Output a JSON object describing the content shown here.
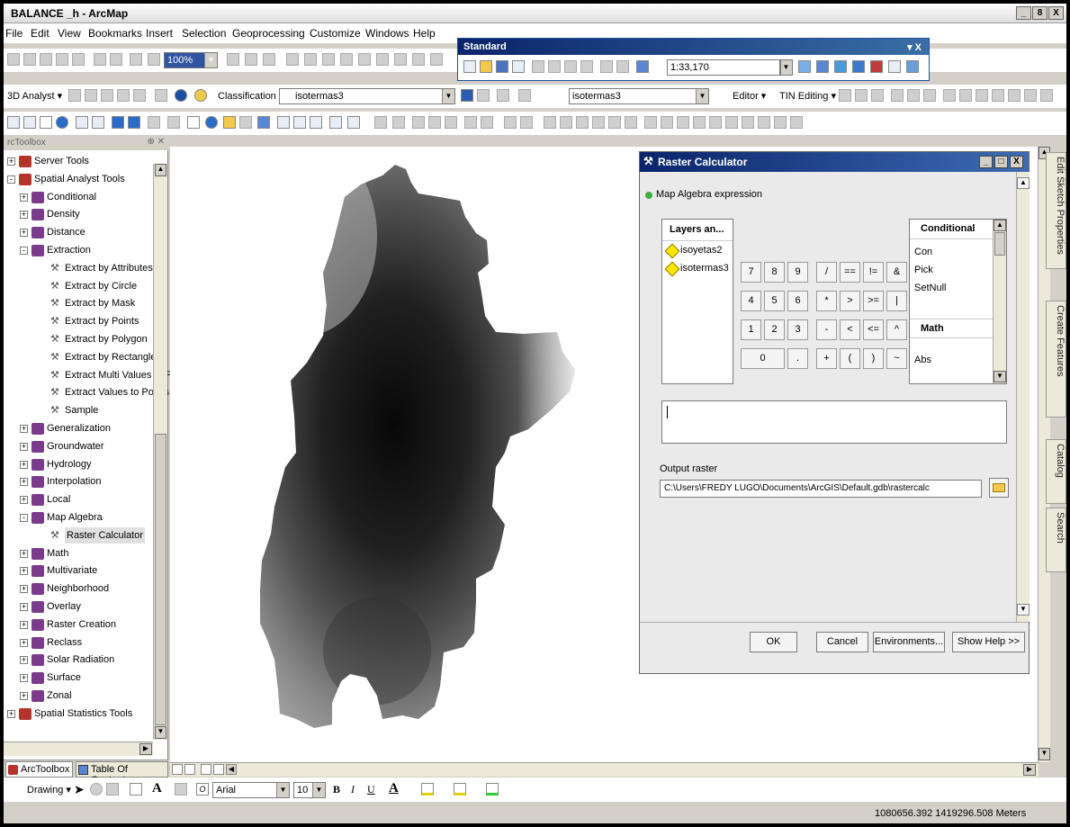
{
  "app": {
    "title": "BALANCE _h - ArcMap"
  },
  "window_buttons": {
    "minimize": "_",
    "restore": "8",
    "close": "X"
  },
  "menu": [
    "File",
    "Edit",
    "View",
    "Bookmarks",
    "Insert",
    "Selection",
    "Geoprocessing",
    "Customize",
    "Windows",
    "Help"
  ],
  "standard_toolbar": {
    "title": "Standard",
    "close": "▾ X",
    "scale": "1:33,170"
  },
  "zoom_level": "100%",
  "analyst_toolbar": {
    "label": "3D Analyst ▾",
    "classification": "Classification ▾",
    "layer": "isotermas3",
    "layer2": "isotermas3",
    "editor": "Editor ▾",
    "tin_editing": "TIN Editing ▾"
  },
  "toolbox": {
    "title": "rcToolbox",
    "items": [
      {
        "label": "Server Tools",
        "type": "toolbox",
        "expand": "+"
      },
      {
        "label": "Spatial Analyst Tools",
        "type": "toolbox",
        "expand": "-"
      },
      {
        "label": "Conditional",
        "type": "set",
        "expand": "+"
      },
      {
        "label": "Density",
        "type": "set",
        "expand": "+"
      },
      {
        "label": "Distance",
        "type": "set",
        "expand": "+"
      },
      {
        "label": "Extraction",
        "type": "set",
        "expand": "-"
      },
      {
        "label": "Extract by Attributes",
        "type": "tool"
      },
      {
        "label": "Extract by Circle",
        "type": "tool"
      },
      {
        "label": "Extract by Mask",
        "type": "tool"
      },
      {
        "label": "Extract by Points",
        "type": "tool"
      },
      {
        "label": "Extract by Polygon",
        "type": "tool"
      },
      {
        "label": "Extract by Rectangle",
        "type": "tool"
      },
      {
        "label": "Extract Multi Values to F",
        "type": "tool"
      },
      {
        "label": "Extract Values to Points",
        "type": "tool"
      },
      {
        "label": "Sample",
        "type": "tool"
      },
      {
        "label": "Generalization",
        "type": "set",
        "expand": "+"
      },
      {
        "label": "Groundwater",
        "type": "set",
        "expand": "+"
      },
      {
        "label": "Hydrology",
        "type": "set",
        "expand": "+"
      },
      {
        "label": "Interpolation",
        "type": "set",
        "expand": "+"
      },
      {
        "label": "Local",
        "type": "set",
        "expand": "+"
      },
      {
        "label": "Map Algebra",
        "type": "set",
        "expand": "-"
      },
      {
        "label": "Raster Calculator",
        "type": "tool",
        "selected": true
      },
      {
        "label": "Math",
        "type": "set",
        "expand": "+"
      },
      {
        "label": "Multivariate",
        "type": "set",
        "expand": "+"
      },
      {
        "label": "Neighborhood",
        "type": "set",
        "expand": "+"
      },
      {
        "label": "Overlay",
        "type": "set",
        "expand": "+"
      },
      {
        "label": "Raster Creation",
        "type": "set",
        "expand": "+"
      },
      {
        "label": "Reclass",
        "type": "set",
        "expand": "+"
      },
      {
        "label": "Solar Radiation",
        "type": "set",
        "expand": "+"
      },
      {
        "label": "Surface",
        "type": "set",
        "expand": "+"
      },
      {
        "label": "Zonal",
        "type": "set",
        "expand": "+"
      },
      {
        "label": "Spatial Statistics Tools",
        "type": "toolbox",
        "expand": "+"
      }
    ]
  },
  "bottom_tabs": {
    "arctoolbox": "ArcToolbox",
    "toc": "Table Of Contents"
  },
  "raster_calculator": {
    "title": "Raster Calculator",
    "expression_label": "Map Algebra expression",
    "layers_header": "Layers an...",
    "layers": [
      "isoyetas2",
      "isotermas3"
    ],
    "keys": [
      [
        "7",
        "8",
        "9",
        "/",
        "==",
        "!=",
        "&"
      ],
      [
        "4",
        "5",
        "6",
        "*",
        ">",
        ">=",
        "|"
      ],
      [
        "1",
        "2",
        "3",
        "-",
        "<",
        "<=",
        "^"
      ],
      [
        "0",
        ".",
        "+",
        "(",
        ")",
        "~"
      ]
    ],
    "functions_header": "Conditional",
    "functions": [
      "Con",
      "Pick",
      "SetNull"
    ],
    "math_header": "Math",
    "math_functions": [
      "Abs"
    ],
    "output_label": "Output raster",
    "output_value": "C:\\Users\\FREDY LUGO\\Documents\\ArcGIS\\Default.gdb\\rastercalc",
    "ok": "OK",
    "cancel": "Cancel",
    "environments": "Environments...",
    "help": "Show Help >>"
  },
  "side_tabs": [
    "Edit Sketch Properties",
    "Create Features",
    "Catalog",
    "Search"
  ],
  "drawing_toolbar": {
    "label": "Drawing ▾",
    "font": "Arial",
    "size": "10",
    "bold": "B",
    "italic": "I",
    "underline": "U",
    "A": "A"
  },
  "status": {
    "coords": "1080656.392  1419296.508 Meters"
  }
}
